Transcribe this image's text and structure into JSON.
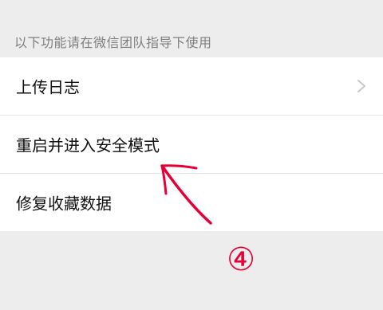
{
  "section": {
    "title": "以下功能请在微信团队指导下使用"
  },
  "items": [
    {
      "label": "上传日志",
      "has_chevron": true
    },
    {
      "label": "重启并进入安全模式",
      "has_chevron": false
    },
    {
      "label": "修复收藏数据",
      "has_chevron": false
    }
  ],
  "annotation": {
    "step_label": "④",
    "color": "#e60036",
    "icon": "arrow-annotation"
  }
}
